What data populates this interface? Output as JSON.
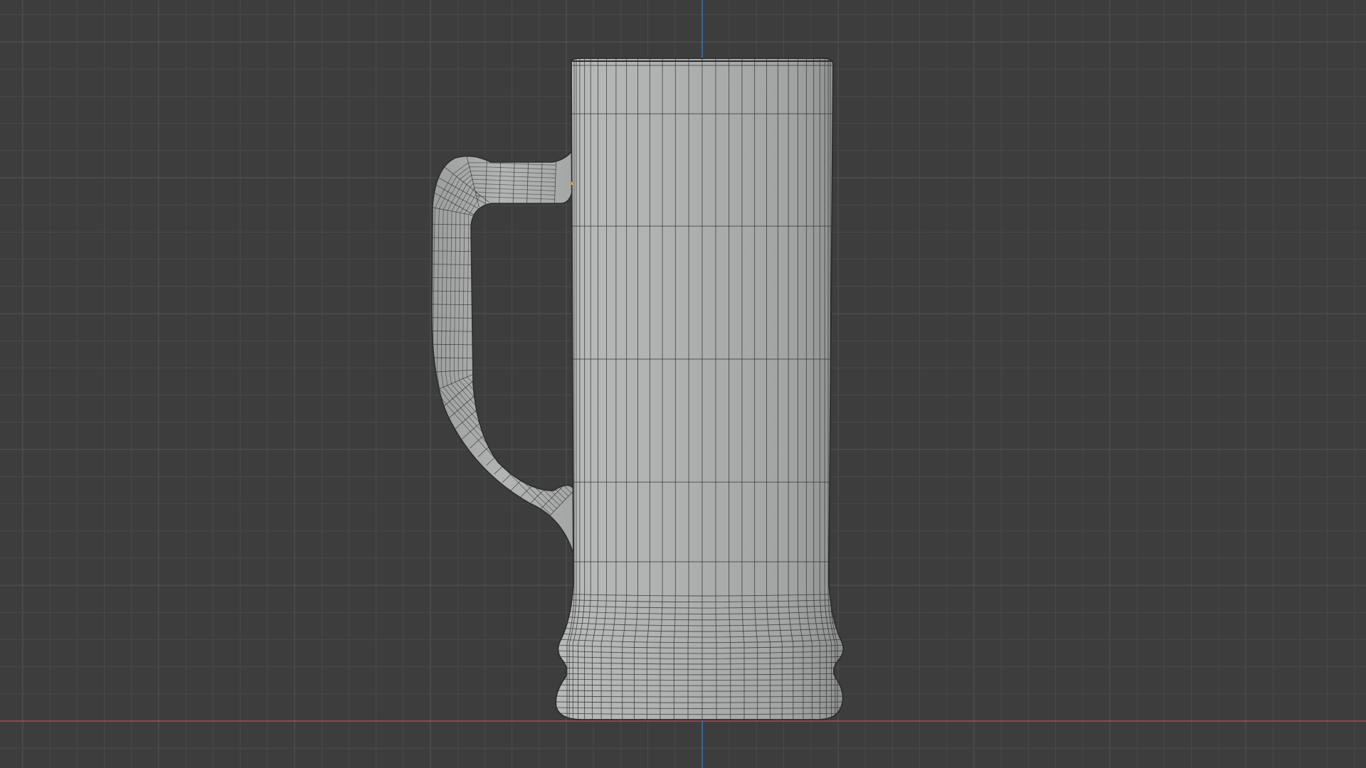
{
  "viewport": {
    "view": "orthographic-side",
    "background_color": "#3d3d3d",
    "grid": {
      "visible": true,
      "minor_line_color": "#494949",
      "major_line_color": "#545454"
    },
    "axes": {
      "x_axis_color": "#b5474f",
      "z_axis_color": "#3a75b8"
    }
  },
  "object": {
    "type": "mesh",
    "shape": "beer-mug",
    "shading": "solid",
    "wireframe_overlay": true,
    "body_color": "#a9abaa",
    "edge_color": "#2c2e2e",
    "parts": [
      "body",
      "handle",
      "base-rings",
      "rim"
    ]
  }
}
